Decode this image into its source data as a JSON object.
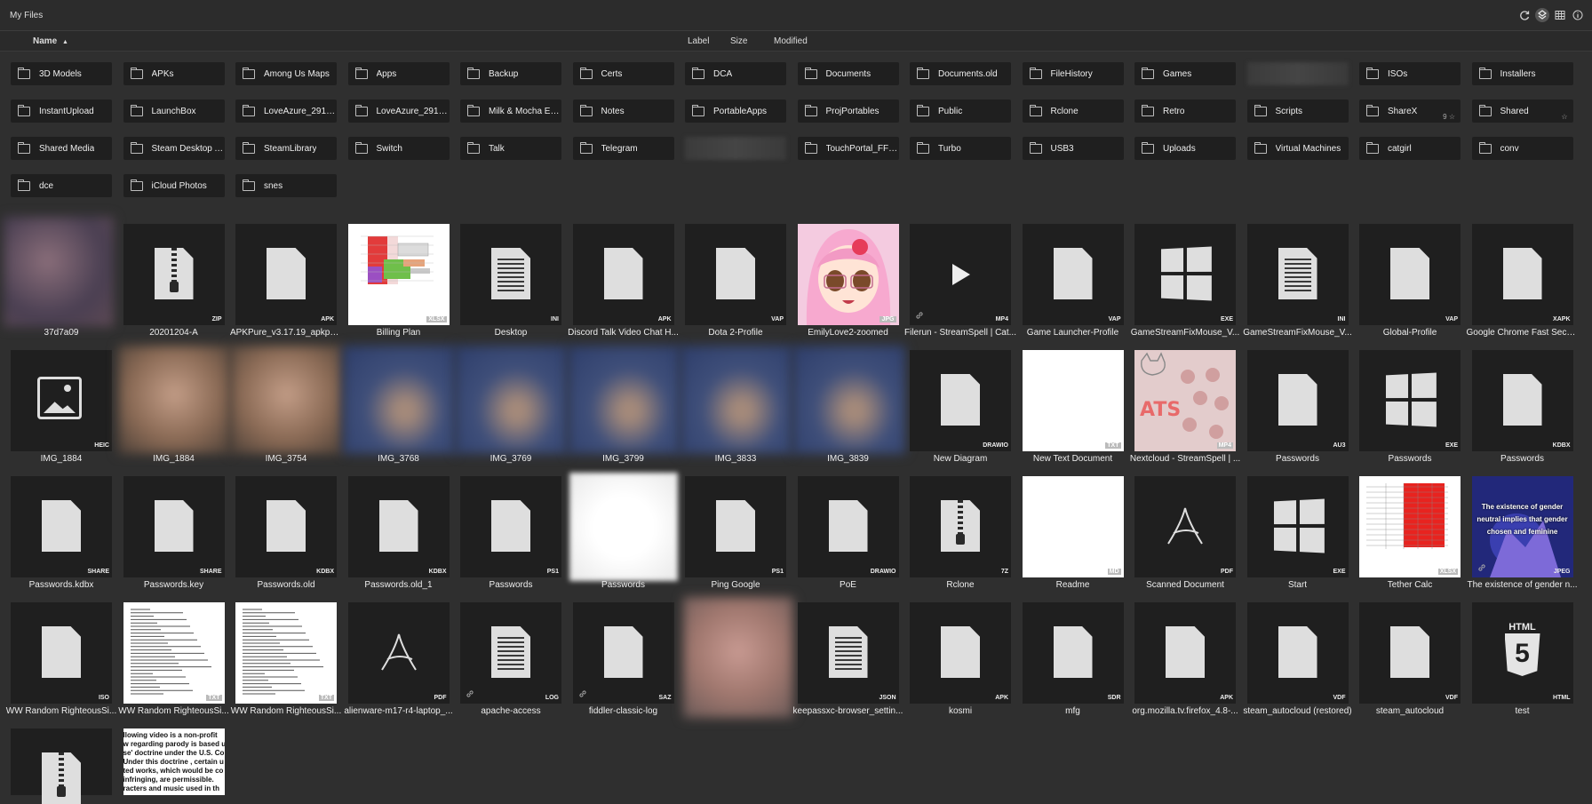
{
  "header": {
    "title": "My Files",
    "icons": [
      "refresh-icon",
      "layers-icon",
      "grid-icon",
      "info-icon"
    ]
  },
  "columns": {
    "name": "Name",
    "sort_indicator": "⬆",
    "label": "Label",
    "size": "Size",
    "modified": "Modified"
  },
  "folders": [
    {
      "name": "3D Models"
    },
    {
      "name": "APKs"
    },
    {
      "name": "Among Us Maps"
    },
    {
      "name": "Apps"
    },
    {
      "name": "Backup"
    },
    {
      "name": "Certs"
    },
    {
      "name": "DCA"
    },
    {
      "name": "Documents"
    },
    {
      "name": "Documents.old"
    },
    {
      "name": "FileHistory"
    },
    {
      "name": "Games"
    },
    {
      "name": ""
    },
    {
      "name": "ISOs"
    },
    {
      "name": "Installers"
    },
    {
      "name": "InstantUpload"
    },
    {
      "name": "LaunchBox"
    },
    {
      "name": "LoveAzure_29193..."
    },
    {
      "name": "LoveAzure_29193..."
    },
    {
      "name": "Milk & Mocha Emo..."
    },
    {
      "name": "Notes"
    },
    {
      "name": "PortableApps"
    },
    {
      "name": "ProjPortables"
    },
    {
      "name": "Public"
    },
    {
      "name": "Rclone"
    },
    {
      "name": "Retro"
    },
    {
      "name": "Scripts"
    },
    {
      "name": "ShareX",
      "badge": "9 ☆"
    },
    {
      "name": "Shared",
      "badge": "☆"
    },
    {
      "name": "Shared Media"
    },
    {
      "name": "Steam Desktop Au..."
    },
    {
      "name": "SteamLibrary"
    },
    {
      "name": "Switch"
    },
    {
      "name": "Talk"
    },
    {
      "name": "Telegram"
    },
    {
      "name": ""
    },
    {
      "name": "TouchPortal_FFXIV"
    },
    {
      "name": "Turbo"
    },
    {
      "name": "USB3"
    },
    {
      "name": "Uploads"
    },
    {
      "name": "Virtual Machines"
    },
    {
      "name": "catgirl"
    },
    {
      "name": "conv"
    },
    {
      "name": "dce"
    },
    {
      "name": "iCloud Photos"
    },
    {
      "name": "snes"
    }
  ],
  "files": [
    {
      "name": "37d7a09",
      "ext": "",
      "kind": "photo"
    },
    {
      "name": "20201204-A",
      "ext": "ZIP",
      "kind": "zip"
    },
    {
      "name": "APKPure_v3.17.19_apkpu...",
      "ext": "APK",
      "kind": "doc"
    },
    {
      "name": "Billing Plan",
      "ext": "XLSX",
      "kind": "sheet"
    },
    {
      "name": "Desktop",
      "ext": "INI",
      "kind": "lines"
    },
    {
      "name": "Discord Talk Video Chat H...",
      "ext": "APK",
      "kind": "doc"
    },
    {
      "name": "Dota 2-Profile",
      "ext": "VAP",
      "kind": "doc"
    },
    {
      "name": "EmilyLove2-zoomed",
      "ext": "JPG",
      "kind": "anime"
    },
    {
      "name": "Filerun - StreamSpell | Cat...",
      "ext": "MP4",
      "kind": "video",
      "link": true
    },
    {
      "name": "Game Launcher-Profile",
      "ext": "VAP",
      "kind": "doc"
    },
    {
      "name": "GameStreamFixMouse_V...",
      "ext": "EXE",
      "kind": "win"
    },
    {
      "name": "GameStreamFixMouse_V...",
      "ext": "INI",
      "kind": "lines"
    },
    {
      "name": "Global-Profile",
      "ext": "VAP",
      "kind": "doc"
    },
    {
      "name": "Google Chrome Fast Secu...",
      "ext": "XAPK",
      "kind": "doc"
    },
    {
      "name": "IMG_1884",
      "ext": "HEIC",
      "kind": "image"
    },
    {
      "name": "IMG_1884",
      "ext": "",
      "kind": "photo2"
    },
    {
      "name": "IMG_3754",
      "ext": "",
      "kind": "photo2"
    },
    {
      "name": "IMG_3768",
      "ext": "",
      "kind": "photo3"
    },
    {
      "name": "IMG_3769",
      "ext": "",
      "kind": "photo3"
    },
    {
      "name": "IMG_3799",
      "ext": "",
      "kind": "photo3"
    },
    {
      "name": "IMG_3833",
      "ext": "",
      "kind": "photo3"
    },
    {
      "name": "IMG_3839",
      "ext": "",
      "kind": "photo3"
    },
    {
      "name": "New Diagram",
      "ext": "DRAWIO",
      "kind": "doc"
    },
    {
      "name": "New Text Document",
      "ext": "TXT",
      "kind": "white"
    },
    {
      "name": "Nextcloud - StreamSpell | ...",
      "ext": "MP4",
      "kind": "cats"
    },
    {
      "name": "Passwords",
      "ext": "AU3",
      "kind": "doc"
    },
    {
      "name": "Passwords",
      "ext": "EXE",
      "kind": "win"
    },
    {
      "name": "Passwords",
      "ext": "KDBX",
      "kind": "doc"
    },
    {
      "name": "Passwords.kdbx",
      "ext": "SHARE",
      "kind": "doc"
    },
    {
      "name": "Passwords.key",
      "ext": "SHARE",
      "kind": "doc"
    },
    {
      "name": "Passwords.old",
      "ext": "KDBX",
      "kind": "doc"
    },
    {
      "name": "Passwords.old_1",
      "ext": "KDBX",
      "kind": "doc"
    },
    {
      "name": "Passwords",
      "ext": "PS1",
      "kind": "doc"
    },
    {
      "name": "Passwords",
      "ext": "",
      "kind": "whiteblur"
    },
    {
      "name": "Ping Google",
      "ext": "PS1",
      "kind": "doc"
    },
    {
      "name": "PoE",
      "ext": "DRAWIO",
      "kind": "doc"
    },
    {
      "name": "Rclone",
      "ext": "7Z",
      "kind": "zip"
    },
    {
      "name": "Readme",
      "ext": "MD",
      "kind": "white"
    },
    {
      "name": "Scanned Document",
      "ext": "PDF",
      "kind": "pdf"
    },
    {
      "name": "Start",
      "ext": "EXE",
      "kind": "win"
    },
    {
      "name": "Tether Calc",
      "ext": "XLSX",
      "kind": "redsheet"
    },
    {
      "name": "The existence of gender n...",
      "ext": "JPEG",
      "kind": "meme",
      "link": true
    },
    {
      "name": "WW Random RighteousSi...",
      "ext": "ISO",
      "kind": "doc"
    },
    {
      "name": "WW Random RighteousSi...",
      "ext": "TXT",
      "kind": "text"
    },
    {
      "name": "WW Random RighteousSi...",
      "ext": "TXT",
      "kind": "text"
    },
    {
      "name": "alienware-m17-r4-laptop_...",
      "ext": "PDF",
      "kind": "pdf"
    },
    {
      "name": "apache-access",
      "ext": "LOG",
      "kind": "lines",
      "link": true
    },
    {
      "name": "fiddler-classic-log",
      "ext": "SAZ",
      "kind": "doc",
      "link": true
    },
    {
      "name": "",
      "ext": "",
      "kind": "pinkblur"
    },
    {
      "name": "keepassxc-browser_settin...",
      "ext": "JSON",
      "kind": "lines"
    },
    {
      "name": "kosmi",
      "ext": "APK",
      "kind": "doc"
    },
    {
      "name": "mfg",
      "ext": "SDR",
      "kind": "doc"
    },
    {
      "name": "org.mozilla.tv.firefox_4.8-...",
      "ext": "APK",
      "kind": "doc"
    },
    {
      "name": "steam_autocloud (restored)",
      "ext": "VDF",
      "kind": "doc"
    },
    {
      "name": "steam_autocloud",
      "ext": "VDF",
      "kind": "doc"
    },
    {
      "name": "test",
      "ext": "HTML",
      "kind": "html5"
    },
    {
      "name": "",
      "ext": "",
      "kind": "zip"
    },
    {
      "name": "",
      "ext": "",
      "kind": "bigtext"
    }
  ],
  "html5_label": "HTML",
  "html5_glyph": "5",
  "pdf_glyph": "∧",
  "bigtext_lines": [
    "llowing video is a non-profit",
    "w regarding parody is based u",
    "se' doctrine under the U.S. Co",
    "Under this doctrine , certain u",
    "ted works, which would be co",
    "infringing, are permissible.",
    "racters and music used in th"
  ],
  "meme_text": "The existence of gender neutral implies that gender chosen and feminine",
  "colors": {
    "bg": "#2f2f2f",
    "tile": "#1f1f1f",
    "icon": "#dedede"
  }
}
